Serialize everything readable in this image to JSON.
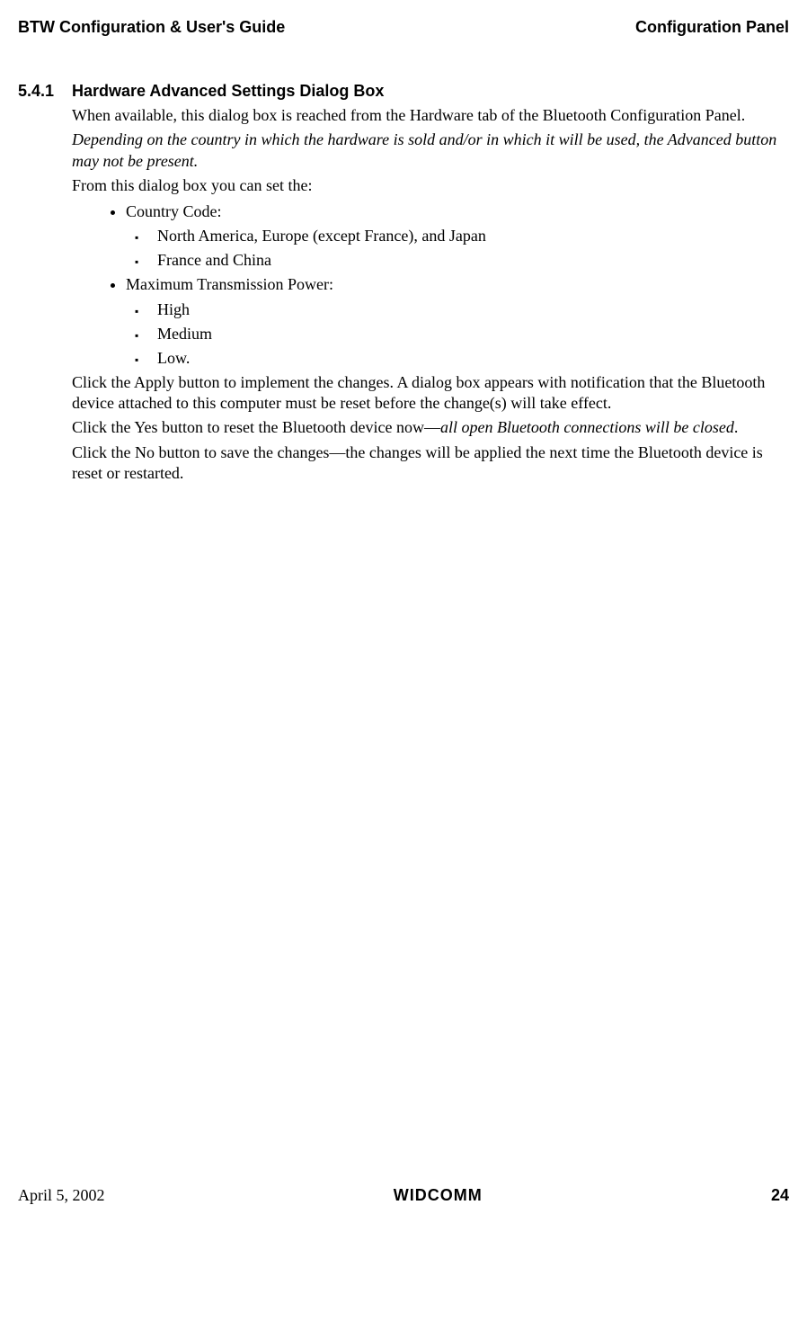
{
  "header": {
    "left": "BTW Configuration & User's Guide",
    "right": "Configuration Panel"
  },
  "section": {
    "number": "5.4.1",
    "title": "Hardware Advanced Settings Dialog Box"
  },
  "body": {
    "p1": "When available, this dialog box is reached from the Hardware tab of the Bluetooth Configuration Panel.",
    "p2": "Depending on the country in which the hardware is sold and/or in which it will be used, the Advanced button may not be present.",
    "p3": "From this dialog box you can set the:",
    "bullets": [
      {
        "label": "Country Code:",
        "sub": [
          "North America, Europe (except France), and Japan",
          "France and China"
        ]
      },
      {
        "label": "Maximum Transmission Power:",
        "sub": [
          "High",
          "Medium",
          "Low."
        ]
      }
    ],
    "p4": "Click the Apply button to implement the changes. A dialog box appears with notification that the Bluetooth device attached to this computer must be reset before the change(s) will take effect.",
    "p5a": "Click the Yes button to reset the Bluetooth device now—",
    "p5b": "all open Bluetooth connections will be closed",
    "p5c": ".",
    "p6": "Click the No button to save the changes—the changes will be applied the next time the Bluetooth device is reset or restarted."
  },
  "footer": {
    "date": "April 5, 2002",
    "company": "WIDCOMM",
    "page": "24"
  }
}
